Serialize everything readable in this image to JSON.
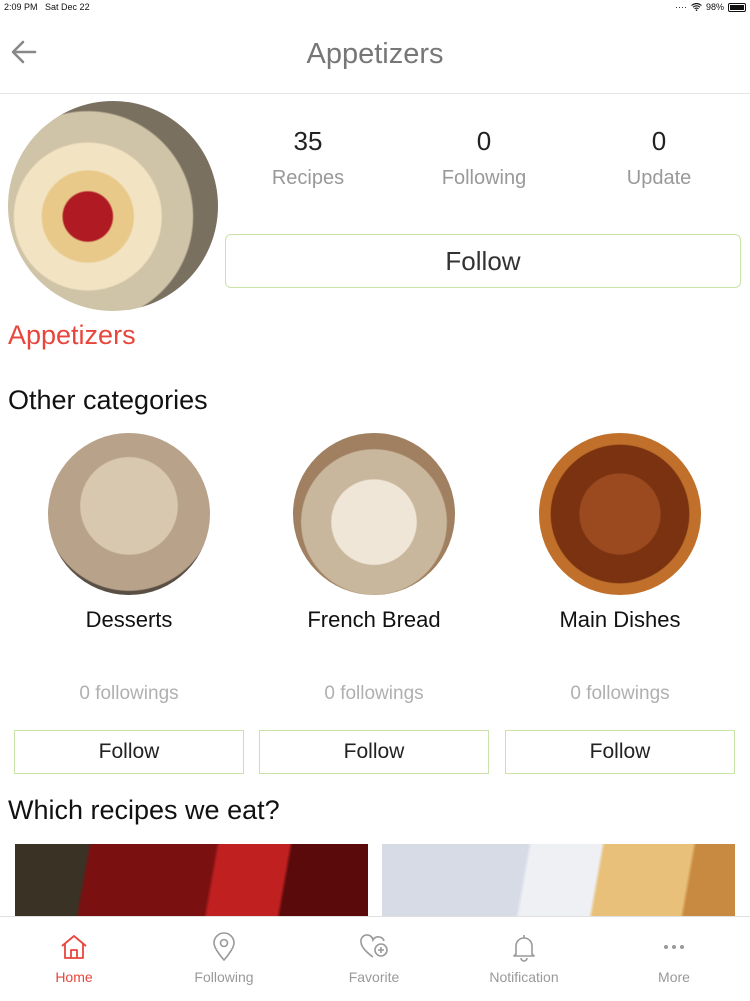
{
  "status_bar": {
    "time": "2:09 PM",
    "date": "Sat Dec 22",
    "battery": "98%"
  },
  "header": {
    "title": "Appetizers"
  },
  "profile": {
    "stats": [
      {
        "value": "35",
        "label": "Recipes"
      },
      {
        "value": "0",
        "label": "Following"
      },
      {
        "value": "0",
        "label": "Update"
      }
    ],
    "follow_label": "Follow",
    "category_name": "Appetizers"
  },
  "other_categories": {
    "title": "Other categories",
    "items": [
      {
        "name": "Desserts",
        "followings": "0 followings",
        "follow_label": "Follow"
      },
      {
        "name": "French Bread",
        "followings": "0 followings",
        "follow_label": "Follow"
      },
      {
        "name": "Main Dishes",
        "followings": "0 followings",
        "follow_label": "Follow"
      }
    ]
  },
  "recipes_section": {
    "title": "Which recipes we eat?"
  },
  "tabbar": {
    "tabs": [
      {
        "label": "Home",
        "icon": "home-icon",
        "active": true
      },
      {
        "label": "Following",
        "icon": "location-pin-icon",
        "active": false
      },
      {
        "label": "Favorite",
        "icon": "heart-plus-icon",
        "active": false
      },
      {
        "label": "Notification",
        "icon": "bell-icon",
        "active": false
      },
      {
        "label": "More",
        "icon": "more-dots-icon",
        "active": false
      }
    ]
  },
  "colors": {
    "accent": "#e8453c",
    "follow_border": "#c9e3a8"
  }
}
